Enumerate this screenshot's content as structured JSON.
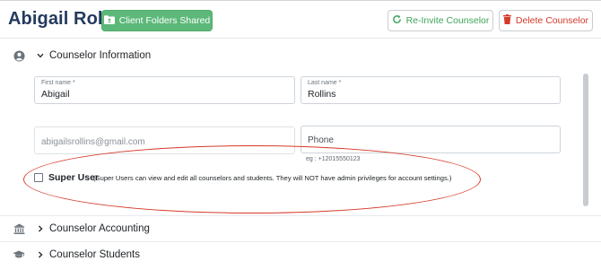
{
  "header": {
    "title": "Abigail Rollins",
    "shared_button": "Client Folders Shared",
    "reinvite_button": "Re-Invite Counselor",
    "delete_button": "Delete Counselor"
  },
  "sections": {
    "info": {
      "label": "Counselor Information",
      "icon": "user-circle-icon",
      "expanded": true
    },
    "accounting": {
      "label": "Counselor Accounting",
      "icon": "bank-icon",
      "expanded": false
    },
    "students": {
      "label": "Counselor Students",
      "icon": "graduation-cap-icon",
      "expanded": false
    }
  },
  "form": {
    "first_name": {
      "label": "First name *",
      "value": "Abigail"
    },
    "last_name": {
      "label": "Last name *",
      "value": "Rollins"
    },
    "email": {
      "placeholder": "abigailsrollins@gmail.com"
    },
    "phone": {
      "placeholder": "Phone",
      "hint": "eg : +12015550123"
    },
    "super_user": {
      "checked": false,
      "label": "Super User",
      "description": "(Super Users can view and edit all counselors and students. They will NOT have admin privileges for account settings.)"
    }
  },
  "colors": {
    "title": "#243a5e",
    "shared_button_bg": "#5cb879",
    "reinvite_text": "#3fa45a",
    "delete_text": "#d6392a",
    "annotation_ellipse": "#d63a2a"
  }
}
